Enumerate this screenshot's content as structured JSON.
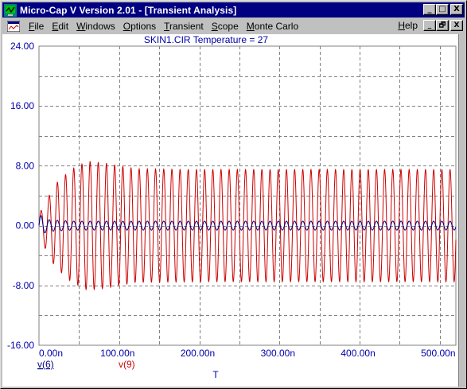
{
  "window": {
    "title": "Micro-Cap V Version 2.01 - [Transient Analysis]",
    "title_buttons": {
      "minimize": "_",
      "maximize": "□",
      "close": "X"
    }
  },
  "menubar": {
    "items": [
      {
        "key": "file",
        "label": "File",
        "ul": "F",
        "rest": "ile"
      },
      {
        "key": "edit",
        "label": "Edit",
        "ul": "E",
        "rest": "dit"
      },
      {
        "key": "windows",
        "label": "Windows",
        "ul": "W",
        "rest": "indows"
      },
      {
        "key": "options",
        "label": "Options",
        "ul": "O",
        "rest": "ptions"
      },
      {
        "key": "transient",
        "label": "Transient",
        "ul": "T",
        "rest": "ransient"
      },
      {
        "key": "scope",
        "label": "Scope",
        "ul": "S",
        "rest": "cope"
      },
      {
        "key": "monte-carlo",
        "label": "Monte Carlo",
        "ul": "M",
        "rest": "onte Carlo"
      }
    ],
    "help": {
      "label": "Help",
      "ul": "H",
      "rest": "elp"
    },
    "doc_buttons": {
      "minimize": "_",
      "restore": "🗗",
      "close": "X"
    }
  },
  "chart_data": {
    "type": "line",
    "title": "SKIN1.CIR Temperature = 27",
    "xlabel": "T",
    "x_unit": "seconds",
    "xlim": [
      0,
      5.2e-07
    ],
    "ylim": [
      -16,
      24
    ],
    "x_ticks": [
      "0.00n",
      "100.00n",
      "200.00n",
      "300.00n",
      "400.00n",
      "500.00n"
    ],
    "x_tick_values": [
      0,
      1e-07,
      2e-07,
      3e-07,
      4e-07,
      5e-07
    ],
    "y_ticks": [
      "24.00",
      "16.00",
      "8.00",
      "0.00",
      "-8.00",
      "-16.00"
    ],
    "y_tick_values": [
      24,
      16,
      8,
      0,
      -8,
      -16
    ],
    "grid": true,
    "grid_style": "dashed",
    "series": [
      {
        "name": "v(6)",
        "color": "#000080",
        "model": "sine",
        "frequency_hz": 98000000.0,
        "amplitude_envelope": [
          [
            0,
            1.5
          ],
          [
            1e-08,
            0.8
          ],
          [
            4e-08,
            0.6
          ],
          [
            5.2e-07,
            0.6
          ]
        ],
        "offset": 0
      },
      {
        "name": "v(9)",
        "color": "#cc0000",
        "model": "sine",
        "frequency_hz": 98000000.0,
        "amplitude_envelope": [
          [
            0,
            1.5
          ],
          [
            5e-09,
            2.5
          ],
          [
            2e-08,
            5.5
          ],
          [
            4e-08,
            7.5
          ],
          [
            6e-08,
            8.6
          ],
          [
            8e-08,
            8.4
          ],
          [
            1.2e-07,
            7.6
          ],
          [
            2e-07,
            7.5
          ],
          [
            5.2e-07,
            7.5
          ]
        ],
        "offset": 0
      }
    ],
    "legend": [
      {
        "label": "v(6)",
        "color": "#000080"
      },
      {
        "label": "v(9)",
        "color": "#cc0000"
      }
    ],
    "colors": {
      "axis_text": "#0000aa",
      "grid": "#808080",
      "border": "#808080"
    }
  }
}
